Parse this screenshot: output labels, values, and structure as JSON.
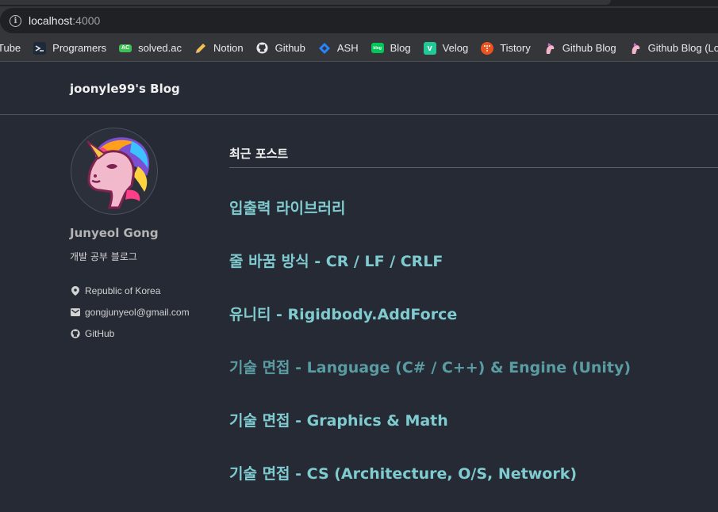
{
  "browser": {
    "url_host": "localhost",
    "url_port": ":4000",
    "bookmarks": [
      {
        "label": "Tube",
        "icon": "youtube-icon"
      },
      {
        "label": "Programers",
        "icon": "programmers-icon"
      },
      {
        "label": "solved.ac",
        "icon": "solvedac-icon",
        "icon_text": "AC"
      },
      {
        "label": "Notion",
        "icon": "pencil-icon"
      },
      {
        "label": "Github",
        "icon": "github-icon"
      },
      {
        "label": "ASH",
        "icon": "jira-icon"
      },
      {
        "label": "Blog",
        "icon": "naver-blog-icon",
        "icon_text": "blog"
      },
      {
        "label": "Velog",
        "icon": "velog-icon",
        "icon_text": "v"
      },
      {
        "label": "Tistory",
        "icon": "tistory-icon"
      },
      {
        "label": "Github Blog",
        "icon": "unicorn-icon"
      },
      {
        "label": "Github Blog (Local)",
        "icon": "unicorn-icon"
      }
    ]
  },
  "site": {
    "title": "joonyle99's Blog"
  },
  "author": {
    "name": "Junyeol Gong",
    "bio": "개발 공부 블로그",
    "location": "Republic of Korea",
    "email": "gongjunyeol@gmail.com",
    "github": "GitHub"
  },
  "main": {
    "section_title": "최근 포스트",
    "posts": [
      {
        "title": "입출력 라이브러리"
      },
      {
        "title": "줄 바꿈 방식 - CR / LF / CRLF"
      },
      {
        "title": "유니티 - Rigidbody.AddForce"
      },
      {
        "title": "기술 면접 - Language (C# / C++) & Engine (Unity)"
      },
      {
        "title": "기술 면접 - Graphics & Math"
      },
      {
        "title": "기술 면접 - CS (Architecture, O/S, Network)"
      }
    ]
  },
  "colors": {
    "page_bg": "#252a34",
    "link": "#7fcbd0",
    "link_hover": "#5a9ca2"
  }
}
